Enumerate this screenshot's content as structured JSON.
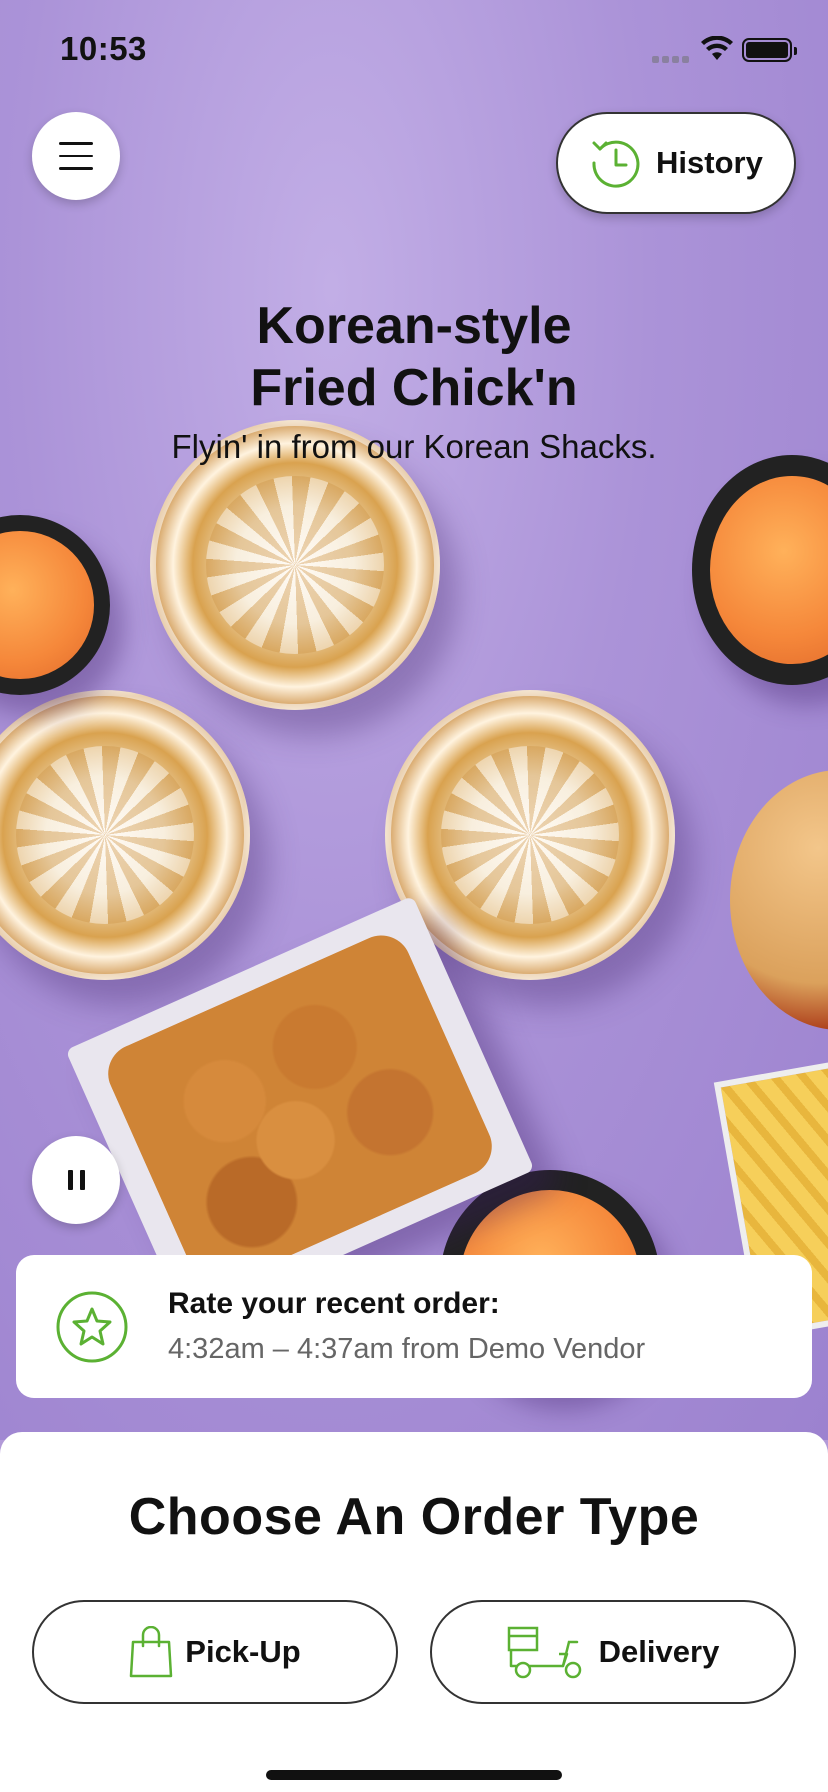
{
  "status_bar": {
    "time": "10:53"
  },
  "header": {
    "history_label": "History"
  },
  "hero": {
    "title_line1": "Korean-style",
    "title_line2": "Fried Chick'n",
    "subtitle": "Flyin' in from our Korean Shacks."
  },
  "rating_card": {
    "title": "Rate your recent order:",
    "detail": "4:32am – 4:37am from Demo Vendor"
  },
  "order_sheet": {
    "title": "Choose An Order Type",
    "pickup_label": "Pick-Up",
    "delivery_label": "Delivery"
  },
  "icons": {
    "menu": "hamburger-icon",
    "history": "clock-history-icon",
    "pause": "pause-icon",
    "rate": "star-icon",
    "pickup": "shopping-bag-icon",
    "delivery": "scooter-icon"
  },
  "colors": {
    "accent": "#5bb133",
    "hero_bg": "#ab93d8"
  }
}
